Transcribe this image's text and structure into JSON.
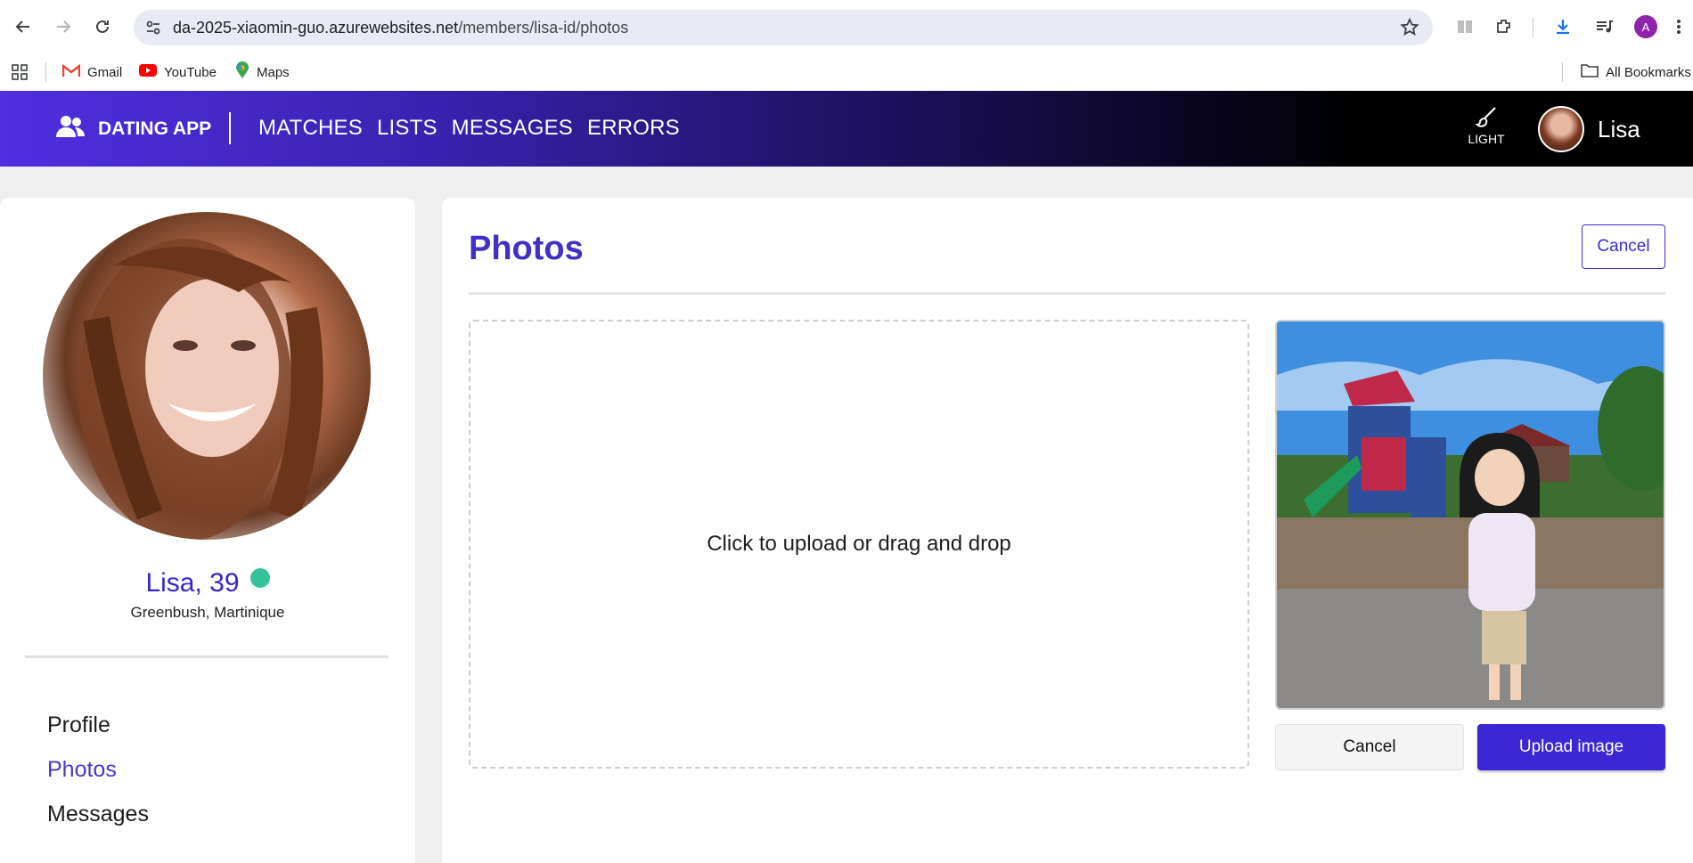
{
  "browser": {
    "url_host": "da-2025-xiaomin-guo.azurewebsites.net",
    "url_path": "/members/lisa-id/photos",
    "profile_initial": "A",
    "bookmarks": [
      {
        "label": "Gmail",
        "icon": "gmail-icon"
      },
      {
        "label": "YouTube",
        "icon": "youtube-icon"
      },
      {
        "label": "Maps",
        "icon": "maps-icon"
      }
    ],
    "all_bookmarks_label": "All Bookmarks"
  },
  "nav": {
    "brand": "DATING APP",
    "links": [
      "MATCHES",
      "LISTS",
      "MESSAGES",
      "ERRORS"
    ],
    "theme_label": "LIGHT",
    "user_name": "Lisa"
  },
  "sidebar": {
    "name_age": "Lisa, 39",
    "location": "Greenbush, Martinique",
    "menu": [
      "Profile",
      "Photos",
      "Messages"
    ],
    "active_item": "Photos"
  },
  "main": {
    "title": "Photos",
    "cancel_label": "Cancel",
    "dropzone_text": "Click to upload or drag and drop",
    "preview_cancel_label": "Cancel",
    "upload_label": "Upload image"
  },
  "colors": {
    "brand_purple": "#3c27d4",
    "online": "#35c29a"
  }
}
